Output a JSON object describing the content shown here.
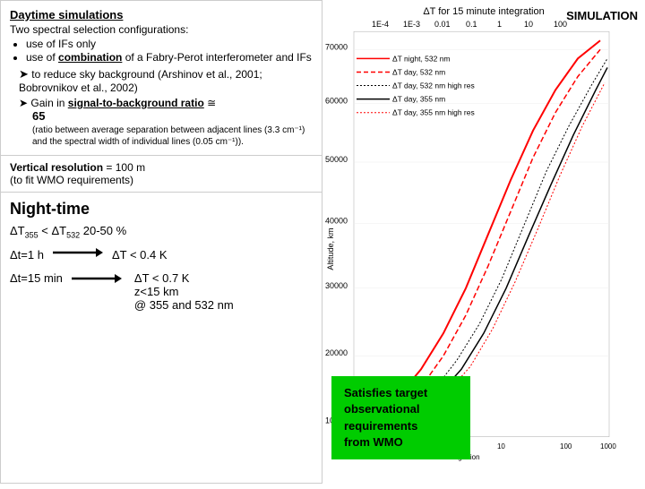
{
  "left": {
    "top": {
      "title": "Daytime simulations",
      "subtitle": "Two spectral selection configurations:",
      "bullet1": "use of IFs only",
      "bullet2_prefix": "use of ",
      "bullet2_combo": "combination",
      "bullet2_suffix": " of a Fabry-Perot",
      "bullet2_line2_prefix": "interferometer ",
      "bullet2_and": "and",
      "bullet2_line2_suffix": " IFs",
      "reduce_prefix": "to reduce sky background ",
      "reduce_cite": "(Arshinov et al., 2001; Bobrovnikov et al., 2002)",
      "gain_prefix": "Gain in ",
      "gain_sig": "signal-to-background ratio",
      "gain_suffix": " ≅",
      "gain_num": "65",
      "gain_detail": "(ratio between average separation between adjacent lines (3.3 cm⁻¹) and the spectral width of individual lines (0.05 cm⁻¹))."
    },
    "resolution": {
      "line1": "Vertical resolution = 100 m",
      "line2": "(to fit WMO requirements)"
    },
    "bottom": {
      "night_title": "Night-time",
      "formula": "ΔT₃₅₅ < ΔT₅₃₂ 20-50 %",
      "row1_left": "Δt=1 h",
      "row1_right": "ΔT < 0.4 K",
      "row2_left": "Δt=15 min",
      "row2_val1": "ΔT < 0.7 K",
      "row2_val2": "z<15 km",
      "row2_val3": "@ 355 and 532 nm"
    }
  },
  "right": {
    "simulation_label": "SIMULATION",
    "chart_title": "ΔT for 15 minute integration",
    "satisfies": {
      "line1": "Satisfies target",
      "line2": "observational",
      "line3": "requirements",
      "line4": "from WMO"
    },
    "legend": [
      {
        "style": "solid_red",
        "label": "ΔT night, 532 nm"
      },
      {
        "style": "dashed_red",
        "label": "ΔT day, 532 nm"
      },
      {
        "style": "dotted_black",
        "label": "ΔT day, 532 nm high res"
      },
      {
        "style": "solid_black",
        "label": "ΔT day, 355 nm"
      },
      {
        "style": "dotted_red",
        "label": "ΔT day, 355 nm high res"
      }
    ]
  }
}
